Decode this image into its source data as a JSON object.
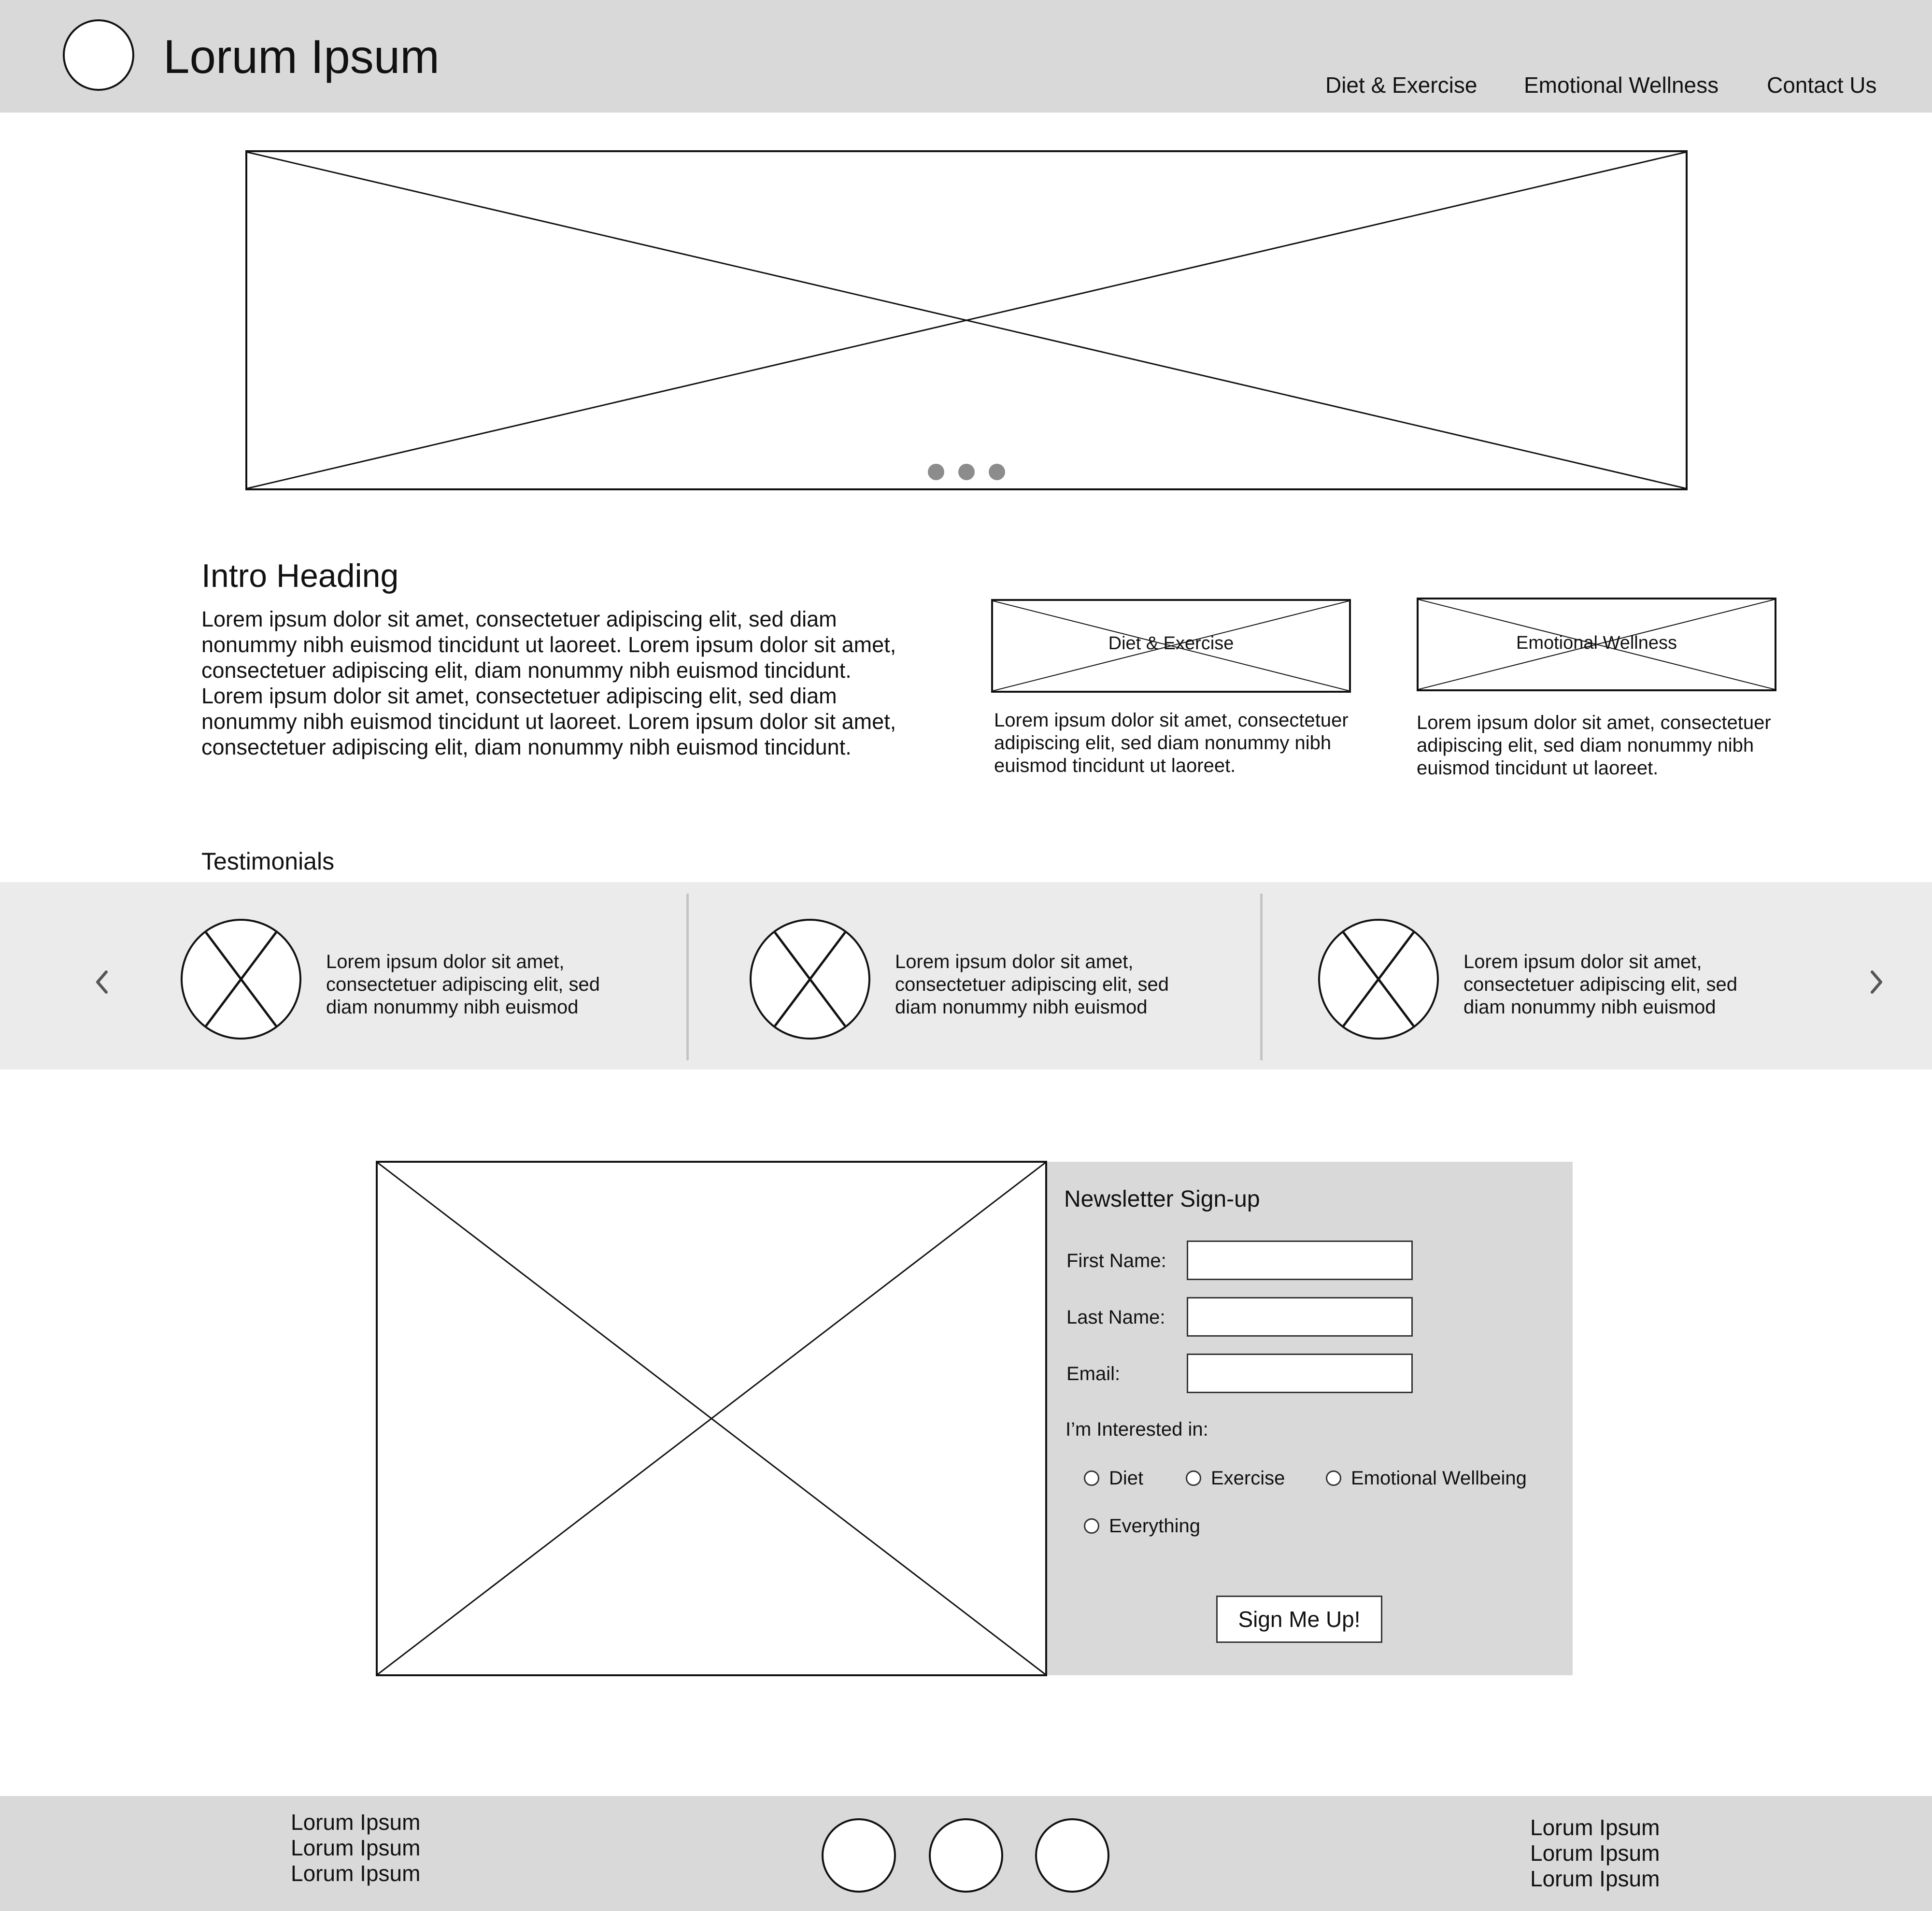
{
  "header": {
    "site_title": "Lorum Ipsum",
    "nav": [
      "Diet & Exercise",
      "Emotional Wellness",
      "Contact Us"
    ]
  },
  "hero": {
    "slide_count": 3
  },
  "intro": {
    "heading": "Intro Heading",
    "body": "Lorem ipsum dolor sit amet, consectetuer adipiscing elit, sed diam nonummy nibh euismod tincidunt ut laoreet. Lorem ipsum dolor sit amet, consectetuer adipiscing elit, diam nonummy nibh euismod tincidunt. Lorem ipsum dolor sit amet, consectetuer adipiscing elit, sed diam nonummy nibh euismod tincidunt ut laoreet. Lorem ipsum dolor sit amet, consectetuer adipiscing elit, diam nonummy nibh euismod tincidunt."
  },
  "features": [
    {
      "label": "Diet & Exercise",
      "text": "Lorem ipsum dolor sit amet, consectetuer adipiscing elit, sed diam nonummy nibh euismod tincidunt ut laoreet."
    },
    {
      "label": "Emotional Wellness",
      "text": "Lorem ipsum dolor sit amet, consectetuer adipiscing elit, sed diam nonummy nibh euismod tincidunt ut laoreet."
    }
  ],
  "testimonials": {
    "title": "Testimonials",
    "items": [
      {
        "text": "Lorem ipsum dolor sit amet, consectetuer adipiscing elit, sed diam nonummy nibh euismod"
      },
      {
        "text": "Lorem ipsum dolor sit amet, consectetuer adipiscing elit, sed diam nonummy nibh euismod"
      },
      {
        "text": "Lorem ipsum dolor sit amet, consectetuer adipiscing elit, sed diam nonummy nibh euismod"
      }
    ],
    "prev_icon": "chevron-left-icon",
    "next_icon": "chevron-right-icon"
  },
  "newsletter": {
    "title": "Newsletter Sign-up",
    "fields": [
      {
        "label": "First Name:",
        "value": ""
      },
      {
        "label": "Last Name:",
        "value": ""
      },
      {
        "label": "Email:",
        "value": ""
      }
    ],
    "interest_label": "I’m Interested in:",
    "options": [
      "Diet",
      "Exercise",
      "Emotional Wellbeing",
      "Everything"
    ],
    "button": "Sign Me Up!"
  },
  "footer": {
    "left": [
      "Lorum Ipsum",
      "Lorum Ipsum",
      "Lorum Ipsum"
    ],
    "right": [
      "Lorum Ipsum",
      "Lorum Ipsum",
      "Lorum Ipsum"
    ],
    "social_count": 3
  },
  "colors": {
    "header_bg": "#d9d9d9",
    "band_bg": "#ebebeb",
    "dot": "#8c8c8c",
    "stroke": "#111111"
  }
}
